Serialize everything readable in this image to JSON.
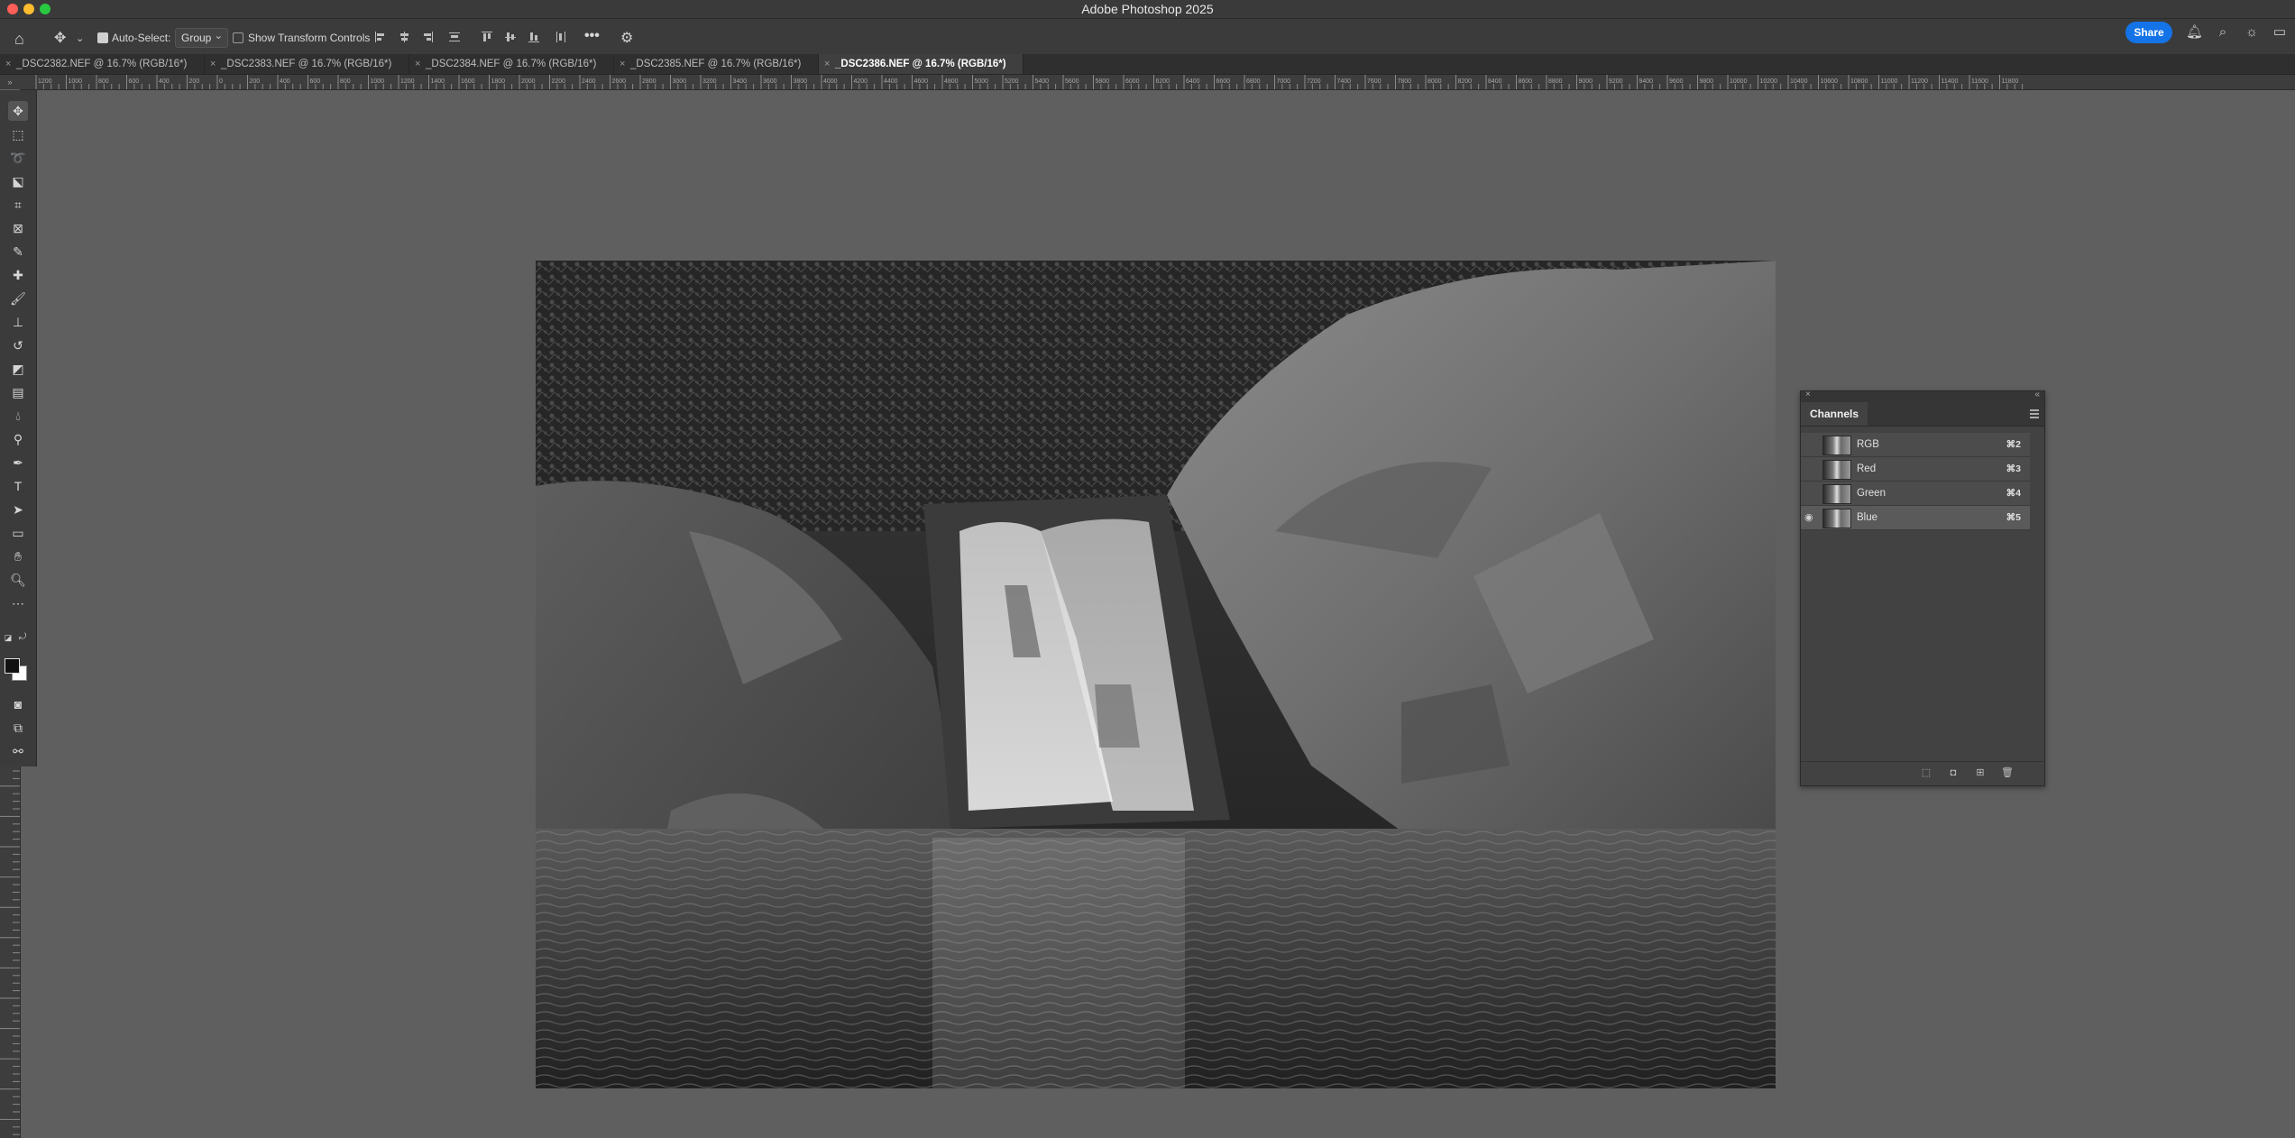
{
  "app": {
    "title": "Adobe Photoshop 2025"
  },
  "options": {
    "auto_select_label": "Auto-Select:",
    "auto_select_checked": true,
    "auto_select_value": "Group",
    "transform_label": "Show Transform Controls",
    "transform_checked": false,
    "more_label": "•••",
    "share_label": "Share"
  },
  "tabs": [
    {
      "label": "_DSC2382.NEF @ 16.7% (RGB/16*)",
      "active": false
    },
    {
      "label": "_DSC2383.NEF @ 16.7% (RGB/16*)",
      "active": false
    },
    {
      "label": "_DSC2384.NEF @ 16.7% (RGB/16*)",
      "active": false
    },
    {
      "label": "_DSC2385.NEF @ 16.7% (RGB/16*)",
      "active": false
    },
    {
      "label": "_DSC2386.NEF @ 16.7% (RGB/16*)",
      "active": true
    }
  ],
  "ruler": {
    "top_labels": [
      "1200",
      "1000",
      "800",
      "600",
      "400",
      "200",
      "0",
      "200",
      "400",
      "600",
      "800",
      "1000",
      "1200",
      "1400",
      "1600",
      "1800",
      "2000",
      "2200",
      "2400",
      "2600",
      "2800",
      "3000",
      "3200",
      "3400",
      "3600",
      "3800",
      "4000",
      "4200",
      "4400",
      "4600",
      "4800",
      "5000",
      "5200",
      "5400",
      "5600",
      "5800",
      "6000",
      "6200",
      "6400",
      "6600",
      "6800",
      "7000",
      "7200",
      "7400",
      "7600",
      "7800",
      "8000",
      "8200",
      "8400",
      "8600",
      "8800",
      "9000",
      "9200",
      "9400",
      "9600",
      "9800",
      "10000",
      "10200",
      "10400",
      "10600",
      "10800",
      "11000",
      "11200",
      "11400",
      "11600",
      "11800"
    ]
  },
  "tools": [
    "move-tool",
    "marquee-tool",
    "lasso-tool",
    "object-selection-tool",
    "crop-tool",
    "frame-tool",
    "eyedropper-tool",
    "spot-healing-tool",
    "brush-tool",
    "clone-stamp-tool",
    "history-brush-tool",
    "eraser-tool",
    "gradient-tool",
    "blur-tool",
    "dodge-tool",
    "pen-tool",
    "type-tool",
    "path-selection-tool",
    "rectangle-tool",
    "hand-tool",
    "zoom-tool",
    "more-tools"
  ],
  "channels_panel": {
    "title": "Channels",
    "channels": [
      {
        "name": "RGB",
        "shortcut": "⌘2",
        "visible": false
      },
      {
        "name": "Red",
        "shortcut": "⌘3",
        "visible": false
      },
      {
        "name": "Green",
        "shortcut": "⌘4",
        "visible": false
      },
      {
        "name": "Blue",
        "shortcut": "⌘5",
        "visible": true
      }
    ]
  }
}
